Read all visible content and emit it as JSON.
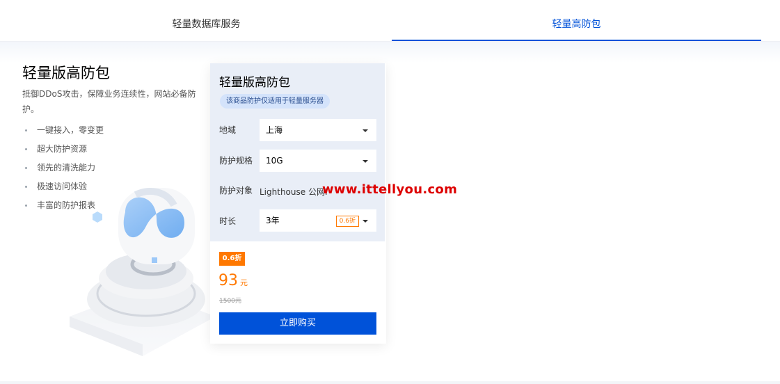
{
  "tabs": [
    {
      "label": "轻量数据库服务"
    },
    {
      "label": "轻量高防包"
    }
  ],
  "intro": {
    "title": "轻量版高防包",
    "subtitle": "抵御DDoS攻击，保障业务连续性，网站必备防护。",
    "features": [
      "一键接入，零变更",
      "超大防护资源",
      "领先的清洗能力",
      "极速访问体验",
      "丰富的防护报表"
    ]
  },
  "card": {
    "title": "轻量版高防包",
    "note": "该商品防护仅适用于轻量服务器",
    "region_label": "地域",
    "region_value": "上海",
    "spec_label": "防护规格",
    "spec_value": "10G",
    "target_label": "防护对象",
    "target_value": "Lighthouse 公网I",
    "duration_label": "时长",
    "duration_value": "3年",
    "duration_discount": "0.6折",
    "discount_badge": "0.6折",
    "price": "93",
    "price_unit": "元",
    "original_price": "1500元",
    "buy_label": "立即购买"
  },
  "watermark": "www.ittellyou.com",
  "colors": {
    "accent": "#0052d9",
    "orange": "#ff7800"
  }
}
